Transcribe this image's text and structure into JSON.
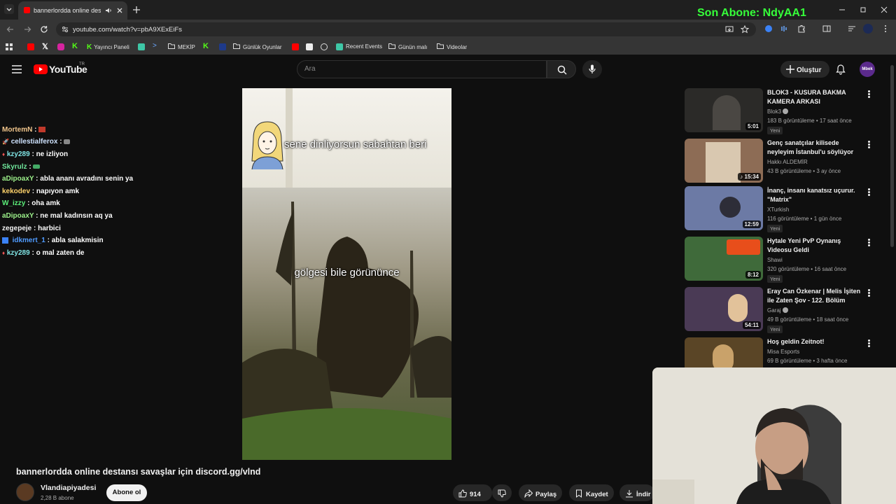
{
  "browser": {
    "tab_title": "bannerlordda online destan",
    "url": "youtube.com/watch?v=pbA9XExEiFs",
    "overlay_text": "Son Abone: NdyAA1",
    "bookmarks": [
      "Yayıncı Paneli",
      "MEKİP",
      "Günlük Oyunlar",
      "Recent Events",
      "Günün malı",
      "Videolar"
    ]
  },
  "youtube": {
    "logo": "YouTube",
    "region": "TR",
    "search_placeholder": "Ara",
    "create_label": "Oluştur",
    "avatar_label": "Mbek"
  },
  "chat": [
    {
      "user": "MortemN",
      "msg": "",
      "color": "#f2c68c"
    },
    {
      "user": "cellestialferox",
      "msg": "",
      "color": "#cfe3ff"
    },
    {
      "user": "kzy289",
      "msg": "ne izliyon",
      "color": "#7fe3e3"
    },
    {
      "user": "Skyrulz",
      "msg": "",
      "color": "#6fe59b"
    },
    {
      "user": "aDipoaxY",
      "msg": "abla ananı avradını senin ya",
      "color": "#9cf08a"
    },
    {
      "user": "kekodev",
      "msg": "napıyon amk",
      "color": "#ffd36b"
    },
    {
      "user": "W_izzy",
      "msg": "oha amk",
      "color": "#5cf07a"
    },
    {
      "user": "aDipoaxY",
      "msg": "ne mal kadınsın aq ya",
      "color": "#9cf08a"
    },
    {
      "user": "zegepeje",
      "msg": "harbici",
      "color": "#f4f4f4"
    },
    {
      "user": "idkmert_1",
      "msg": "abla salakmisin",
      "color": "#4f9bff"
    },
    {
      "user": "kzy289",
      "msg": "o mal zaten de",
      "color": "#7fe3e3"
    }
  ],
  "video": {
    "caption_top": "sene dinliyorsun sabahtan beri",
    "caption_mid": "gölgesi bile görününce",
    "title": "bannerlordda online destansı savaşlar için discord.gg/vlnd",
    "channel": "Vlandiapiyadesi",
    "subs": "2,28 B abone",
    "subscribe_label": "Abone ol",
    "likes": "914",
    "share_label": "Paylaş",
    "save_label": "Kaydet",
    "download_label": "İndir"
  },
  "recommendations": [
    {
      "title": "BLOK3 - KUSURA BAKMA KAMERA ARKASI",
      "channel": "Blok3",
      "meta": "183 B görüntüleme • 17 saat önce",
      "duration": "5:01",
      "new": "Yeni",
      "color": "#2b2a28"
    },
    {
      "title": "Genç sanatçılar kilisede neyleyim İstanbul'u söylüyor",
      "channel": "Hakkı ALDEMİR",
      "meta": "43 B görüntüleme • 3 ay önce",
      "duration": "15:34",
      "new": "",
      "color": "#8d6c55"
    },
    {
      "title": "İnanç, insanı kanatsız uçurur. \"Matrix\"",
      "channel": "XTurkish",
      "meta": "116 görüntüleme • 1 gün önce",
      "duration": "12:59",
      "new": "Yeni",
      "color": "#6c7aa5"
    },
    {
      "title": "Hytale Yeni PvP Oynanış Videosu Geldi",
      "channel": "Shawi",
      "meta": "320 görüntüleme • 16 saat önce",
      "duration": "8:12",
      "new": "Yeni",
      "color": "#3f6a3a"
    },
    {
      "title": "Eray Can Özkenar | Melis İşiten ile Zaten Şov - 122. Bölüm",
      "channel": "Garaj",
      "meta": "49 B görüntüleme • 18 saat önce",
      "duration": "54:11",
      "new": "Yeni",
      "color": "#4a3a55"
    },
    {
      "title": "Hoş geldin Zeitnot!",
      "channel": "Misa Esports",
      "meta": "69 B görüntüleme • 3 hafta önce",
      "duration": "",
      "new": "",
      "color": "#5a4526"
    }
  ]
}
